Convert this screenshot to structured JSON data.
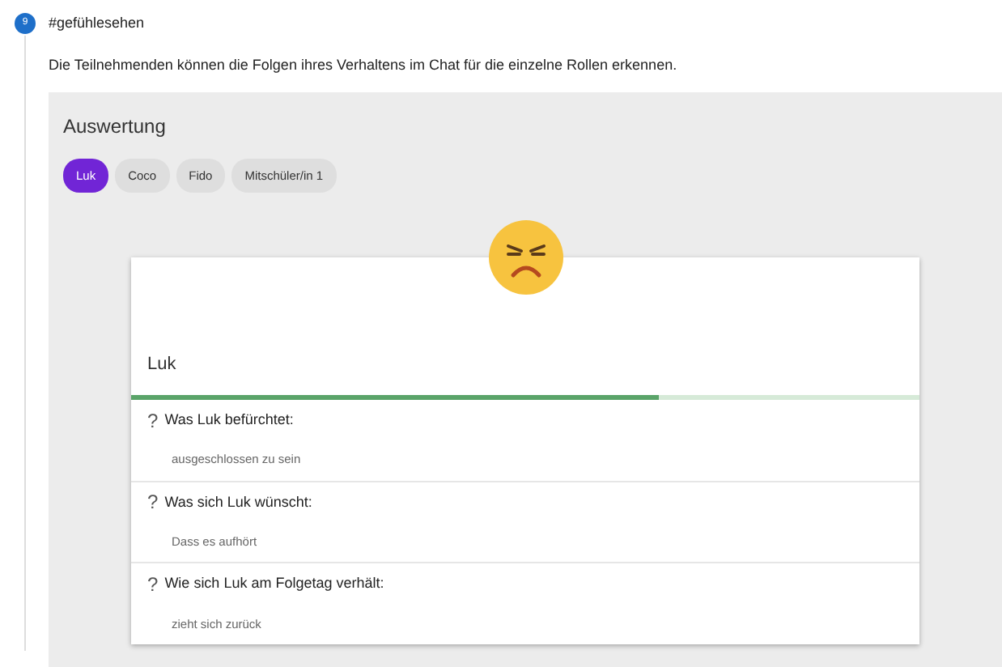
{
  "step": {
    "number": "9",
    "title": "#gefühlesehen"
  },
  "description": "Die Teilnehmenden können die Folgen ihres Verhaltens im Chat für die einzelne Rollen erkennen.",
  "panel": {
    "title": "Auswertung",
    "chips": [
      {
        "label": "Luk",
        "selected": true
      },
      {
        "label": "Coco",
        "selected": false
      },
      {
        "label": "Fido",
        "selected": false
      },
      {
        "label": "Mitschüler/in 1",
        "selected": false
      }
    ],
    "card": {
      "name": "Luk",
      "progress": {
        "level": 0.67
      },
      "questions": [
        {
          "icon": "?",
          "question": "Was Luk befürchtet:",
          "answer": "ausgeschlossen zu sein"
        },
        {
          "icon": "?",
          "question": "Was sich Luk wünscht:",
          "answer": "Dass es aufhört"
        },
        {
          "icon": "?",
          "question": "Wie sich Luk am Folgetag verhält:",
          "answer": "zieht sich zurück"
        }
      ]
    }
  }
}
